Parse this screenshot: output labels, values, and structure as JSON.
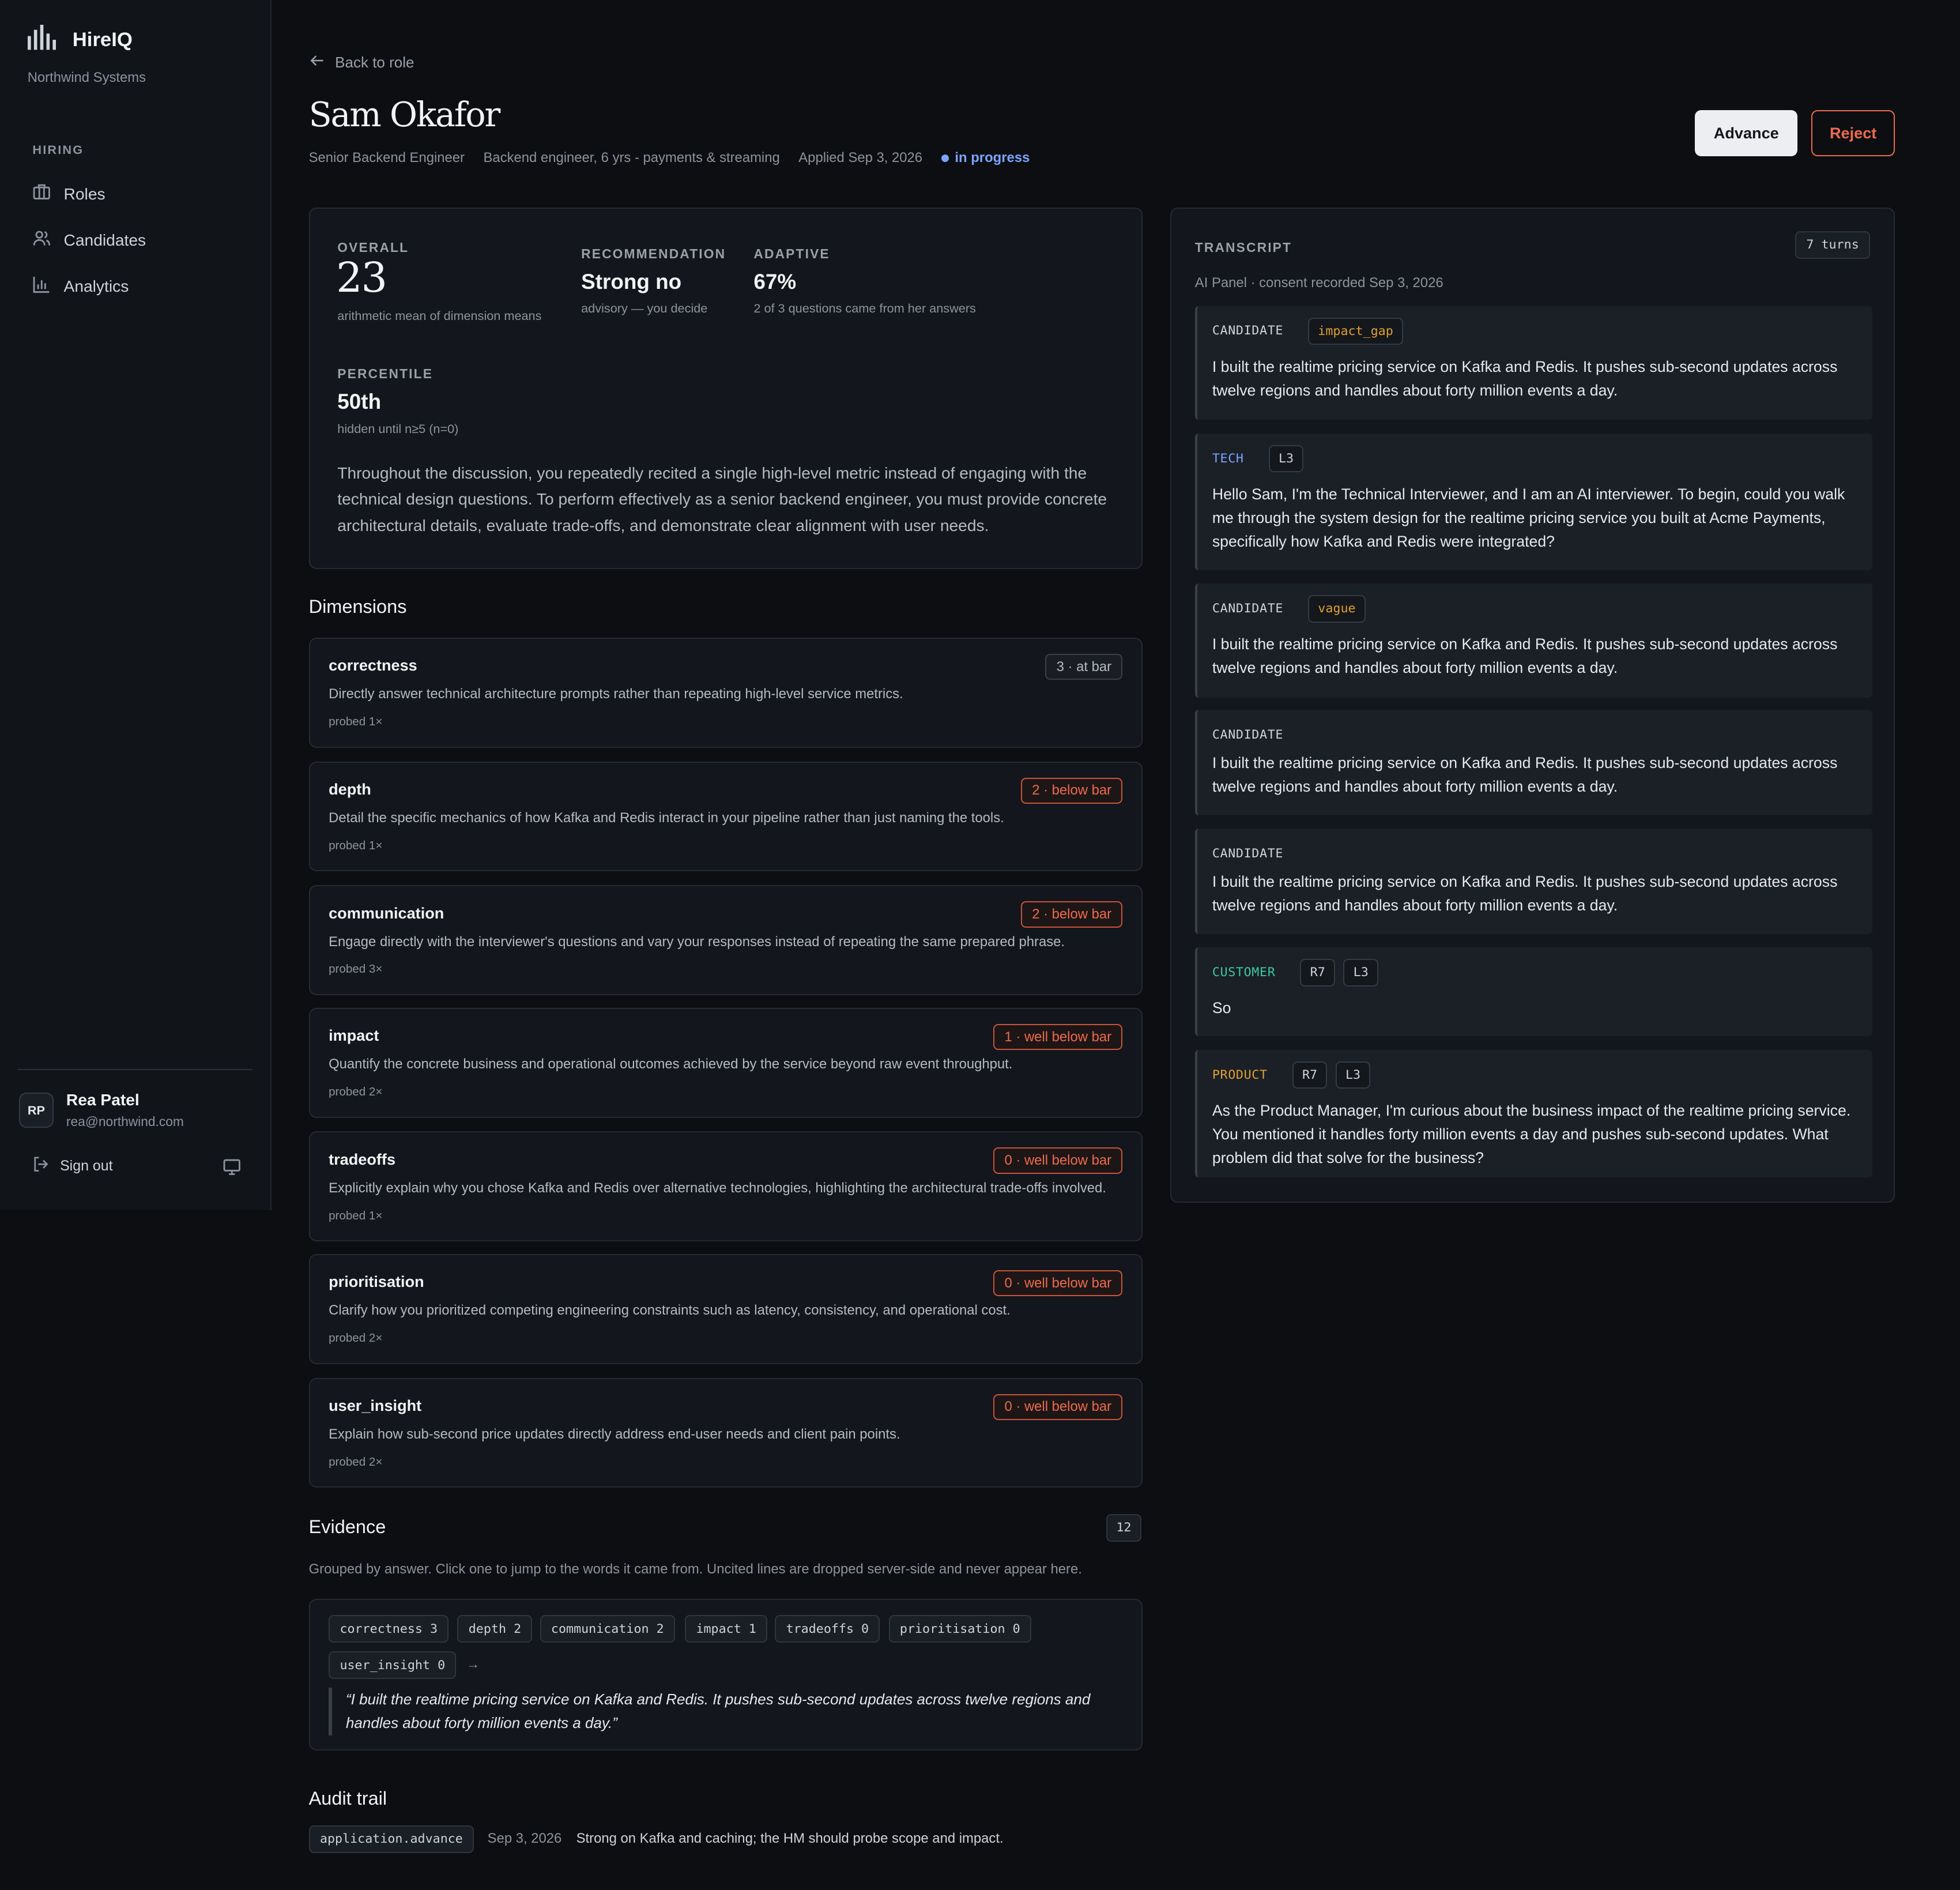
{
  "app": {
    "name": "HireIQ",
    "org": "Northwind Systems"
  },
  "sidebar": {
    "section": "HIRING",
    "items": [
      {
        "label": "Roles"
      },
      {
        "label": "Candidates"
      },
      {
        "label": "Analytics"
      }
    ]
  },
  "user": {
    "initials": "RP",
    "name": "Rea Patel",
    "email": "rea@northwind.com",
    "signout": "Sign out"
  },
  "header": {
    "back": "Back to role",
    "name": "Sam Okafor",
    "role": "Senior Backend Engineer",
    "summary": "Backend engineer, 6 yrs - payments & streaming",
    "applied": "Applied Sep 3, 2026",
    "status": "in progress",
    "advance": "Advance",
    "reject": "Reject"
  },
  "score": {
    "overall_label": "OVERALL",
    "overall_value": "23",
    "overall_sub": "arithmetic mean of dimension means",
    "rec_label": "RECOMMENDATION",
    "rec_value": "Strong no",
    "rec_sub": "advisory — you decide",
    "adaptive_label": "ADAPTIVE",
    "adaptive_value": "67%",
    "adaptive_sub": "2 of 3 questions came from her answers",
    "pct_label": "PERCENTILE",
    "pct_value": "50th",
    "pct_sub": "hidden until n≥5 (n=0)",
    "text": "Throughout the discussion, you repeatedly recited a single high-level metric instead of engaging with the technical design questions. To perform effectively as a senior backend engineer, you must provide concrete architectural details, evaluate trade-offs, and demonstrate clear alignment with user needs."
  },
  "dimensions": {
    "title": "Dimensions",
    "items": [
      {
        "name": "correctness",
        "desc": "Directly answer technical architecture prompts rather than repeating high-level service metrics.",
        "probed": "probed 1×",
        "badge": "3 · at bar",
        "tone": "neutral"
      },
      {
        "name": "depth",
        "desc": "Detail the specific mechanics of how Kafka and Redis interact in your pipeline rather than just naming the tools.",
        "probed": "probed 1×",
        "badge": "2 · below bar",
        "tone": "red"
      },
      {
        "name": "communication",
        "desc": "Engage directly with the interviewer's questions and vary your responses instead of repeating the same prepared phrase.",
        "probed": "probed 3×",
        "badge": "2 · below bar",
        "tone": "red"
      },
      {
        "name": "impact",
        "desc": "Quantify the concrete business and operational outcomes achieved by the service beyond raw event throughput.",
        "probed": "probed 2×",
        "badge": "1 · well below bar",
        "tone": "red"
      },
      {
        "name": "tradeoffs",
        "desc": "Explicitly explain why you chose Kafka and Redis over alternative technologies, highlighting the architectural trade-offs involved.",
        "probed": "probed 1×",
        "badge": "0 · well below bar",
        "tone": "red"
      },
      {
        "name": "prioritisation",
        "desc": "Clarify how you prioritized competing engineering constraints such as latency, consistency, and operational cost.",
        "probed": "probed 2×",
        "badge": "0 · well below bar",
        "tone": "red"
      },
      {
        "name": "user_insight",
        "desc": "Explain how sub-second price updates directly address end-user needs and client pain points.",
        "probed": "probed 2×",
        "badge": "0 · well below bar",
        "tone": "red"
      }
    ]
  },
  "evidence": {
    "title": "Evidence",
    "count": "12",
    "subtitle": "Grouped by answer. Click one to jump to the words it came from. Uncited lines are dropped server-side and never appear here.",
    "chips": [
      "correctness 3",
      "depth 2",
      "communication 2",
      "impact 1",
      "tradeoffs 0",
      "prioritisation 0",
      "user_insight 0"
    ],
    "arrow": "→",
    "quote": "“I built the realtime pricing service on Kafka and Redis. It pushes sub-second updates across twelve regions and handles about forty million events a day.”"
  },
  "audit": {
    "title": "Audit trail",
    "event": "application.advance",
    "date": "Sep 3, 2026",
    "text": "Strong on Kafka and caching; the HM should probe scope and impact."
  },
  "transcript": {
    "title": "TRANSCRIPT",
    "turns_badge": "7 turns",
    "subtitle": "AI Panel · consent recorded Sep 3, 2026",
    "turns": [
      {
        "role": "CANDIDATE",
        "tags": [
          "impact_gap"
        ],
        "text": "I built the realtime pricing service on Kafka and Redis. It pushes sub-second updates across twelve regions and handles about forty million events a day."
      },
      {
        "role": "TECH",
        "tags": [
          "L3"
        ],
        "text": "Hello Sam, I'm the Technical Interviewer, and I am an AI interviewer. To begin, could you walk me through the system design for the realtime pricing service you built at Acme Payments, specifically how Kafka and Redis were integrated?"
      },
      {
        "role": "CANDIDATE",
        "tags": [
          "vague"
        ],
        "text": "I built the realtime pricing service on Kafka and Redis. It pushes sub-second updates across twelve regions and handles about forty million events a day."
      },
      {
        "role": "CANDIDATE",
        "tags": [],
        "text": "I built the realtime pricing service on Kafka and Redis. It pushes sub-second updates across twelve regions and handles about forty million events a day."
      },
      {
        "role": "CANDIDATE",
        "tags": [],
        "text": "I built the realtime pricing service on Kafka and Redis. It pushes sub-second updates across twelve regions and handles about forty million events a day."
      },
      {
        "role": "CUSTOMER",
        "tags": [
          "R7",
          "L3"
        ],
        "text": "So"
      },
      {
        "role": "PRODUCT",
        "tags": [
          "R7",
          "L3"
        ],
        "text": "As the Product Manager, I'm curious about the business impact of the realtime pricing service. You mentioned it handles forty million events a day and pushes sub-second updates. What problem did that solve for the business?"
      }
    ]
  },
  "colors": {
    "accent_blue": "#7ba4ff",
    "danger": "#ef6a4c",
    "tag_orange": "#e0a030",
    "customer_teal": "#3cc8a0",
    "product_amber": "#e0a030"
  }
}
